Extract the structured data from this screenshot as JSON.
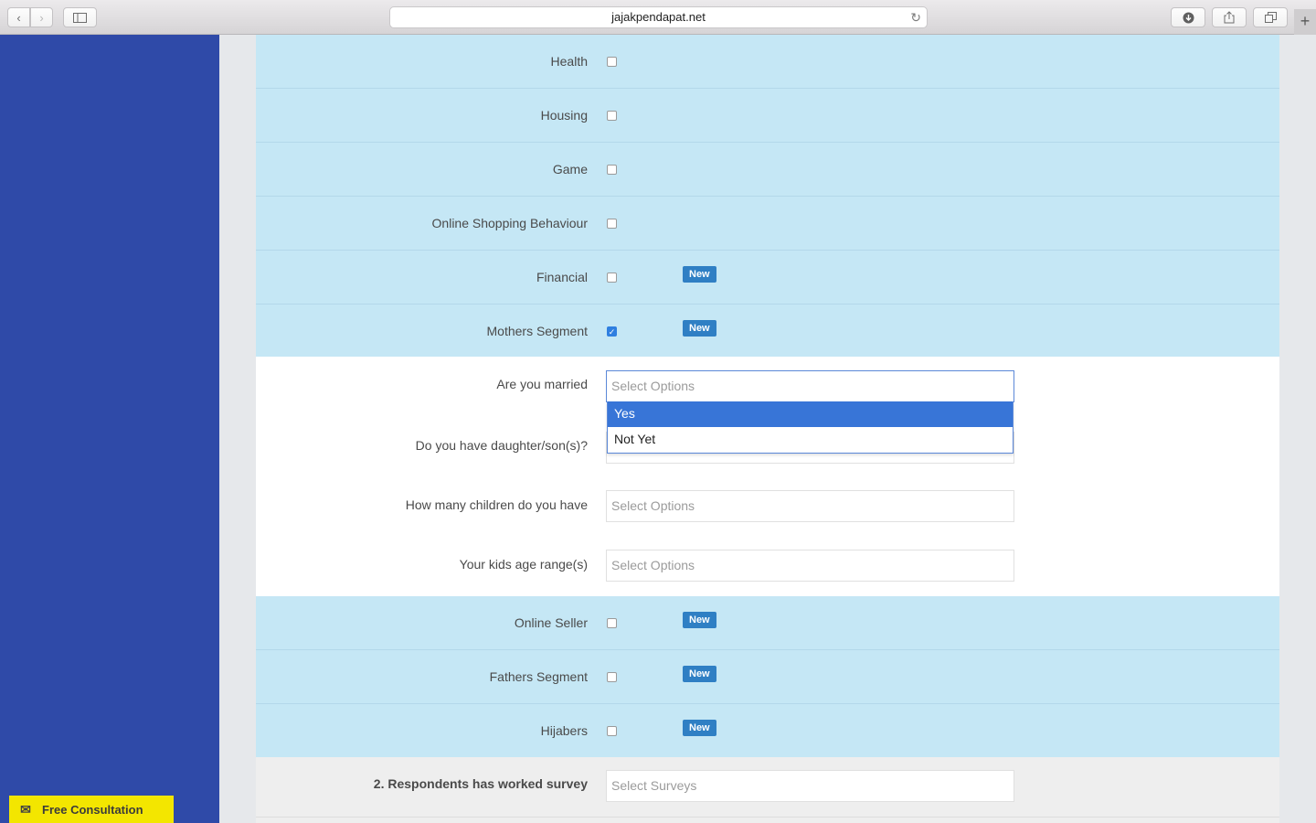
{
  "browser": {
    "url": "jajakpendapat.net"
  },
  "consultation": {
    "label": "Free Consultation"
  },
  "categories_top": [
    {
      "label": "Health",
      "checked": false,
      "badge": ""
    },
    {
      "label": "Housing",
      "checked": false,
      "badge": ""
    },
    {
      "label": "Game",
      "checked": false,
      "badge": ""
    },
    {
      "label": "Online Shopping Behaviour",
      "checked": false,
      "badge": ""
    },
    {
      "label": "Financial",
      "checked": false,
      "badge": "New"
    },
    {
      "label": "Mothers Segment",
      "checked": true,
      "badge": "New"
    }
  ],
  "mothers_questions": {
    "married": {
      "label": "Are you married",
      "placeholder": "Select Options"
    },
    "children": {
      "label": "Do you have daughter/son(s)?"
    },
    "count": {
      "label": "How many children do you have",
      "placeholder": "Select Options"
    },
    "ages": {
      "label": "Your kids age range(s)",
      "placeholder": "Select Options"
    },
    "dropdown_options": [
      "Yes",
      "Not Yet"
    ],
    "highlighted_option": "Yes"
  },
  "categories_bottom": [
    {
      "label": "Online Seller",
      "checked": false,
      "badge": "New"
    },
    {
      "label": "Fathers Segment",
      "checked": false,
      "badge": "New"
    },
    {
      "label": "Hijabers",
      "checked": false,
      "badge": "New"
    }
  ],
  "surveys": {
    "label": "2. Respondents has worked survey",
    "placeholder": "Select Surveys"
  },
  "colors": {
    "sidebar": "#2f4aa8",
    "row_bg": "#c5e7f5",
    "badge": "#2f7fc4",
    "consult_bg": "#f3e600",
    "dropdown_active": "#3875d7"
  }
}
